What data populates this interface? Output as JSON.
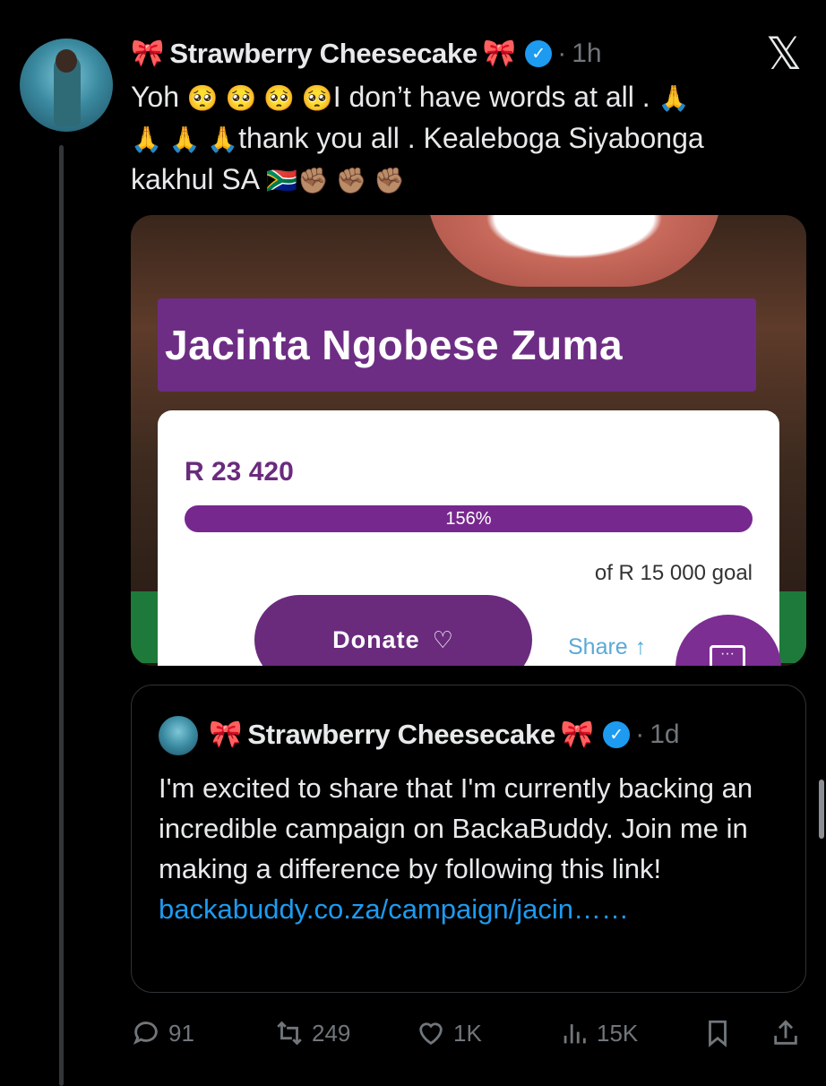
{
  "tweet": {
    "bow_left": "🎀",
    "name": "Strawberry Cheesecake",
    "bow_right": "🎀",
    "verified_mark": "✓",
    "dot": "·",
    "time": "1h",
    "close_glyph": "𝕏",
    "line1_a": "Yoh ",
    "line1_emoji": "🥺 🥺 🥺 🥺",
    "line1_b": "I don’t have words at all . ",
    "pray": "🙏",
    "line2_emoji": "🙏 🙏 🙏",
    "line2_b": "thank you all . Kealeboga Siyabonga",
    "line3_a": "kakhul SA ",
    "flag": "🇿🇦",
    "fists": "✊🏽 ✊🏽 ✊🏽"
  },
  "media": {
    "banner_name": "Jacinta Ngobese Zuma",
    "amount": "R 23 420",
    "progress_percent": "156%",
    "progress_fraction": 1.0,
    "goal": "of R 15 000 goal",
    "donate_label": "Donate",
    "heart": "♡",
    "share_label": "Share",
    "share_icon": "↑"
  },
  "quote": {
    "bow_left": "🎀",
    "name": "Strawberry Cheesecake",
    "bow_right": "🎀",
    "verified_mark": "✓",
    "dot": "·",
    "time": "1d",
    "text": "I'm excited to share that I'm currently backing an incredible campaign on BackaBuddy. Join me in making a difference by following this link!",
    "link": "backabuddy.co.za/campaign/jacin……"
  },
  "actions": {
    "replies": "91",
    "retweets": "249",
    "likes": "1K",
    "views": "15K"
  },
  "colors": {
    "background": "#000000",
    "text": "#e7e9ea",
    "muted": "#71767b",
    "link": "#1d9bf0",
    "verified": "#1d9bf0",
    "campaign_purple": "#77288f"
  },
  "icons": [
    "reply-icon",
    "retweet-icon",
    "like-icon",
    "views-icon",
    "bookmark-icon",
    "share-icon",
    "x-logo-icon",
    "verified-icon"
  ]
}
